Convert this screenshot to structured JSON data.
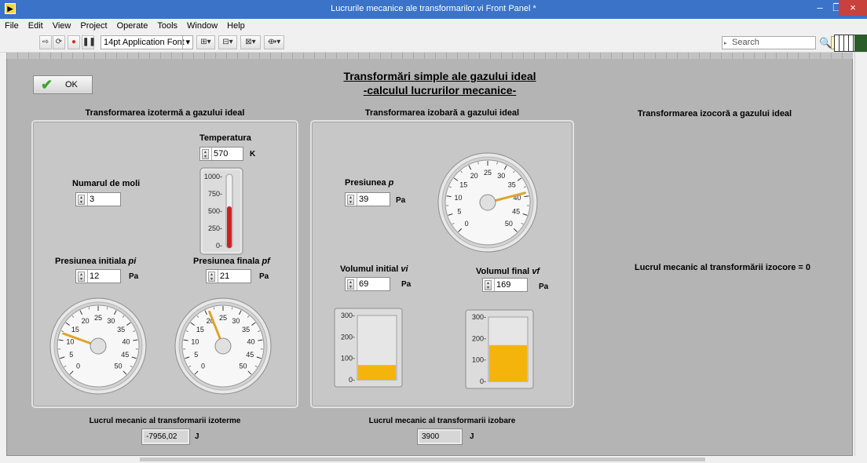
{
  "window": {
    "title": "Lucrurile mecanice ale transformarilor.vi Front Panel *",
    "controls": [
      "–",
      "❐",
      "×"
    ]
  },
  "menu": [
    "File",
    "Edit",
    "View",
    "Project",
    "Operate",
    "Tools",
    "Window",
    "Help"
  ],
  "toolbar": {
    "font": "14pt Application Font",
    "search_placeholder": "Search"
  },
  "ok_button": {
    "label": "OK"
  },
  "header": {
    "line1": "Transformări simple ale gazului ideal",
    "line2": "-calculul lucrurilor mecanice-"
  },
  "isothermal": {
    "title": "Transformarea izotermă a gazului ideal",
    "temperature_label": "Temperatura",
    "temperature_value": "570",
    "temperature_unit": "K",
    "thermometer_ticks": [
      "1000",
      "750",
      "500",
      "250",
      "0"
    ],
    "thermometer_level": 570,
    "thermometer_max": 1000,
    "moles_label": "Numarul de moli",
    "moles_value": "3",
    "p_initial_label": "Presiunea initiala",
    "p_initial_symbol": "pi",
    "p_initial_value": "12",
    "p_initial_unit": "Pa",
    "p_final_label": "Presiunea finala",
    "p_final_symbol": "pf",
    "p_final_value": "21",
    "p_final_unit": "Pa",
    "gauge_initial_value": 12,
    "gauge_final_value": 21,
    "work_label": "Lucrul mecanic al transformarii izoterme",
    "work_value": "-7956,02",
    "work_unit": "J"
  },
  "isobaric": {
    "title": "Transformarea izobară a gazului ideal",
    "pressure_label": "Presiunea",
    "pressure_symbol": "p",
    "pressure_value": "39",
    "pressure_unit": "Pa",
    "gauge_value": 39,
    "v_initial_label": "Volumul initial",
    "v_initial_symbol": "vi",
    "v_initial_value": "69",
    "v_initial_unit": "Pa",
    "v_final_label": "Volumul final",
    "v_final_symbol": "vf",
    "v_final_value": "169",
    "v_final_unit": "Pa",
    "tank_ticks": [
      "300",
      "200",
      "100",
      "0"
    ],
    "tank_max": 300,
    "tank_initial_level": 69,
    "tank_final_level": 169,
    "work_label": "Lucrul mecanic al transformarii izobare",
    "work_value": "3900",
    "work_unit": "J"
  },
  "isochoric": {
    "title": "Transformarea izocoră a gazului ideal",
    "work_text": "Lucrul mecanic al transformării izocore = 0"
  },
  "gauge_ticks": [
    "0",
    "5",
    "10",
    "15",
    "20",
    "25",
    "30",
    "35",
    "40",
    "45",
    "50"
  ],
  "gauge_max": 50,
  "colors": {
    "needle": "#e0a32a",
    "fill": "#f5b40b",
    "mercury": "#d11f1f",
    "titlebar": "#3a73c8"
  }
}
